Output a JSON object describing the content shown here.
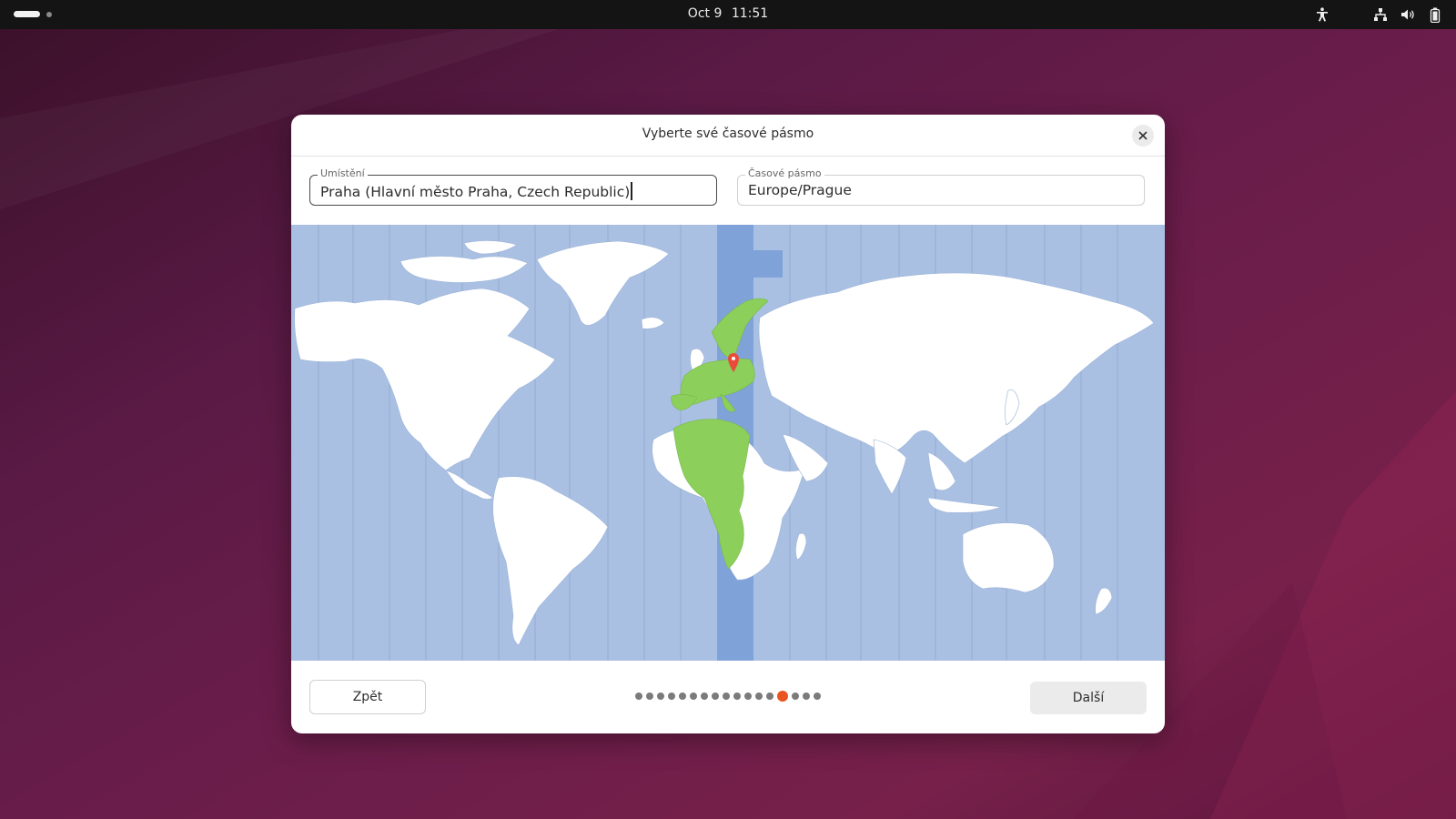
{
  "topbar": {
    "date": "Oct 9",
    "time": "11:51",
    "icons": [
      "accessibility-icon",
      "network-icon",
      "volume-icon",
      "battery-icon"
    ]
  },
  "dialog": {
    "title": "Vyberte své časové pásmo",
    "location": {
      "label": "Umístění",
      "value": "Praha (Hlavní město Praha, Czech Republic)"
    },
    "timezone": {
      "label": "Časové pásmo",
      "value": "Europe/Prague"
    },
    "back_label": "Zpět",
    "next_label": "Další",
    "steps": {
      "total": 17,
      "current": 14
    }
  },
  "colors": {
    "accent": "#e95420",
    "map_ocean": "#a9c0e3",
    "map_selected_zone": "#7fa2d8",
    "map_selected_land": "#8ccf5a",
    "map_land": "#ffffff"
  }
}
